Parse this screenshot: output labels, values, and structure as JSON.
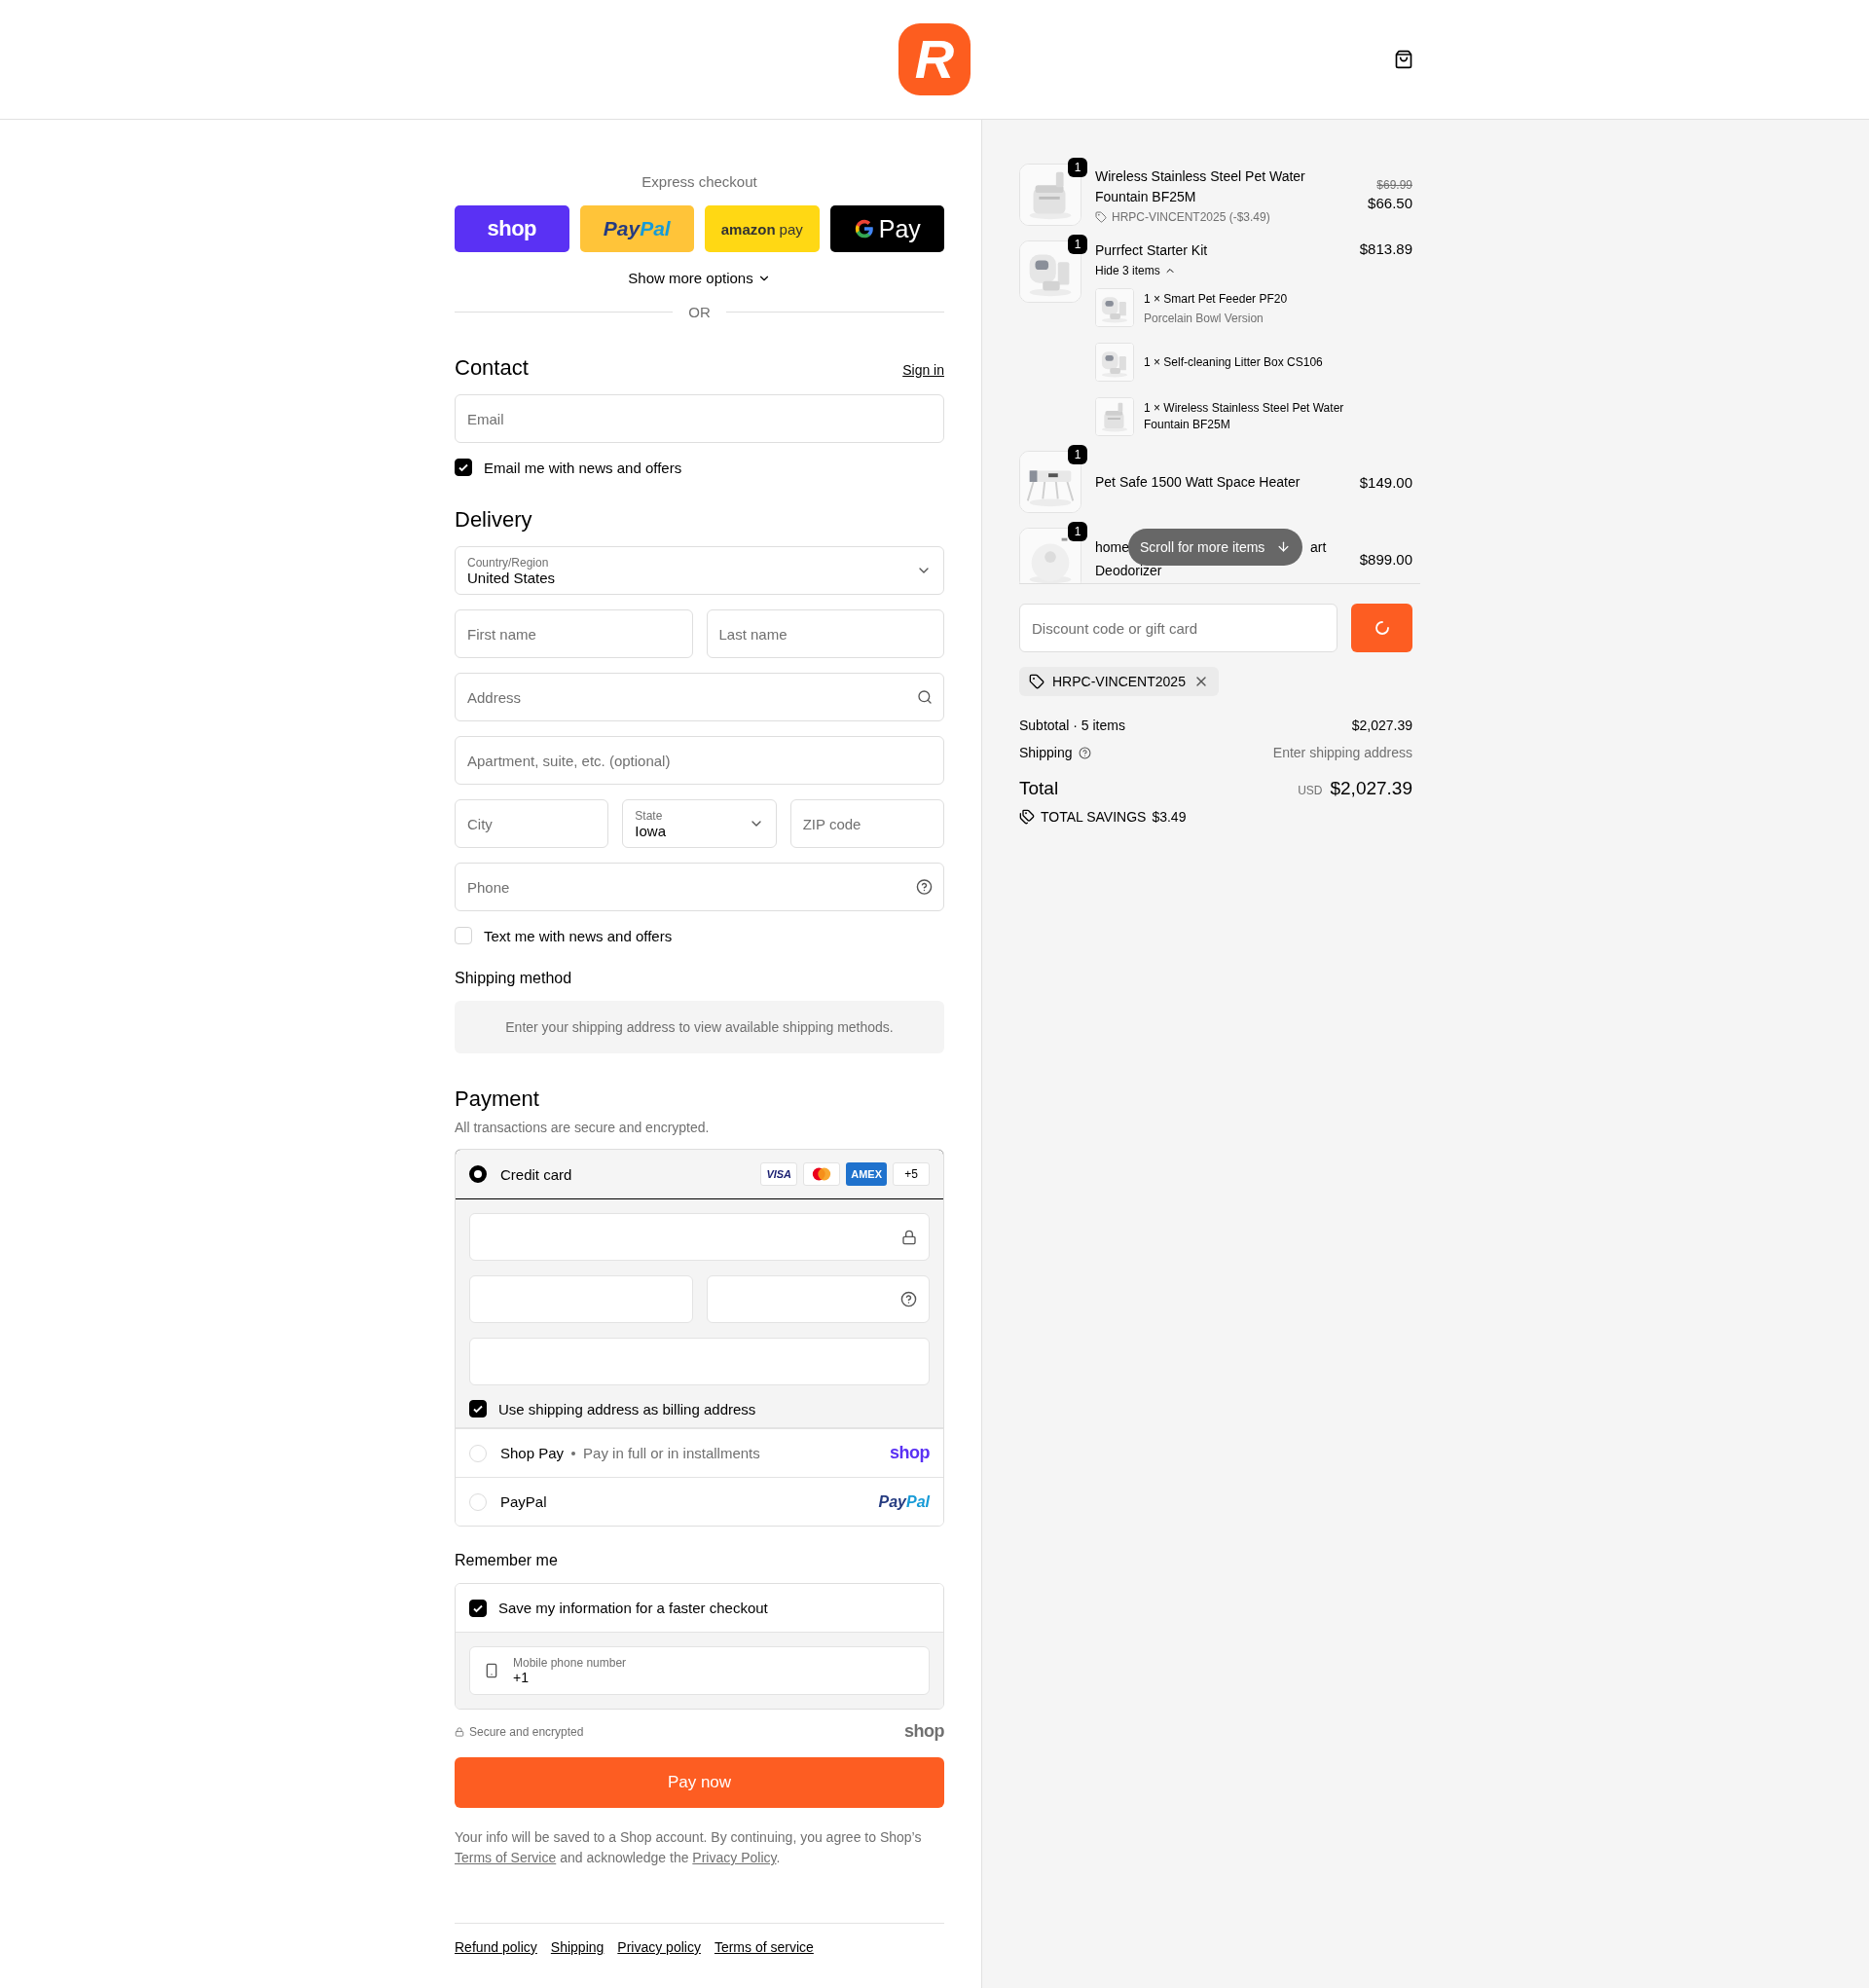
{
  "header": {
    "logo_letter": "R"
  },
  "express": {
    "title": "Express checkout",
    "buttons": [
      {
        "kind": "shop",
        "parts": [
          "shop"
        ]
      },
      {
        "kind": "paypal",
        "parts": [
          "Pay",
          "Pal"
        ]
      },
      {
        "kind": "amazon",
        "parts": [
          "amazon",
          "pay"
        ]
      },
      {
        "kind": "gpay",
        "parts": [
          "Pay"
        ]
      }
    ],
    "more": "Show more options",
    "divider": "OR"
  },
  "contact": {
    "title": "Contact",
    "sign_in": "Sign in",
    "email": {
      "placeholder": "Email"
    },
    "offers": {
      "label": "Email me with news and offers",
      "checked": true
    }
  },
  "delivery": {
    "title": "Delivery",
    "country": {
      "label": "Country/Region",
      "value": "United States"
    },
    "first_name": {
      "placeholder": "First name"
    },
    "last_name": {
      "placeholder": "Last name"
    },
    "address": {
      "placeholder": "Address"
    },
    "apartment": {
      "placeholder": "Apartment, suite, etc. (optional)"
    },
    "city": {
      "placeholder": "City"
    },
    "state": {
      "label": "State",
      "value": "Iowa"
    },
    "zip": {
      "placeholder": "ZIP code"
    },
    "phone": {
      "placeholder": "Phone"
    },
    "sms": {
      "label": "Text me with news and offers",
      "checked": false
    }
  },
  "shipping_method": {
    "title": "Shipping method",
    "notice": "Enter your shipping address to view available shipping methods."
  },
  "payment": {
    "title": "Payment",
    "subtitle": "All transactions are secure and encrypted.",
    "methods": [
      {
        "kind": "card",
        "label": "Credit card",
        "selected": true,
        "brands": [
          {
            "kind": "visa",
            "label": "VISA"
          },
          {
            "kind": "mastercard"
          },
          {
            "kind": "amex",
            "label": "AMEX"
          },
          {
            "kind": "more",
            "label": "+5"
          }
        ]
      },
      {
        "kind": "shop_pay",
        "label": "Shop Pay",
        "note": "Pay in full or in installments",
        "logo_parts": [
          "shop"
        ],
        "selected": false
      },
      {
        "kind": "paypal",
        "label": "PayPal",
        "logo_parts": [
          "Pay",
          "Pal"
        ],
        "selected": false
      }
    ],
    "billing": {
      "label": "Use shipping address as billing address",
      "checked": true
    }
  },
  "remember": {
    "title": "Remember me",
    "save": {
      "label": "Save my information for a faster checkout",
      "checked": true
    },
    "phone": {
      "label": "Mobile phone number",
      "value": "+1"
    }
  },
  "secure": "Secure and encrypted",
  "shop_logo": "shop",
  "pay_button": "Pay now",
  "legal": [
    {
      "text": "Your info will be saved to a Shop account. By continuing, you agree to Shop’s "
    },
    {
      "text": "Terms of Service",
      "link": true
    },
    {
      "text": " and acknowledge the "
    },
    {
      "text": "Privacy Policy",
      "link": true
    },
    {
      "text": "."
    }
  ],
  "footer_links": [
    "Refund policy",
    "Shipping",
    "Privacy policy",
    "Terms of service"
  ],
  "summary": {
    "items": [
      {
        "kind": "full",
        "quantity": "1",
        "name": "Wireless Stainless Steel Pet Water Fountain BF25M",
        "compare_price": "$69.99",
        "price": "$66.50",
        "discount": "HRPC-VINCENT2025 (-$3.49)"
      },
      {
        "kind": "full",
        "quantity": "1",
        "name": "Purrfect Starter Kit",
        "price": "$813.89",
        "toggle": "Hide 3 items",
        "expanded": true,
        "components": [
          {
            "label": "1 × Smart Pet Feeder PF20",
            "variant": "Porcelain Bowl Version"
          },
          {
            "label": "1 × Self-cleaning Litter Box CS106"
          },
          {
            "label": "1 × Wireless Stainless Steel Pet Water Fountain BF25M"
          }
        ]
      },
      {
        "kind": "full",
        "quantity": "1",
        "name": "Pet Safe 1500 Watt Space Heater",
        "price": "$149.00"
      },
      {
        "kind": "partial",
        "quantity": "1",
        "name_parts": [
          "home",
          "art",
          "Deodorizer"
        ],
        "price": "$899.00"
      }
    ],
    "scroll_hint": "Scroll for more items",
    "discount": {
      "placeholder": "Discount code or gift card"
    },
    "applied_code": "HRPC-VINCENT2025",
    "subtotal": {
      "label": "Subtotal · 5 items",
      "value": "$2,027.39"
    },
    "shipping": {
      "label": "Shipping",
      "value": "Enter shipping address"
    },
    "total": {
      "label": "Total",
      "currency": "USD",
      "value": "$2,027.39"
    },
    "savings": {
      "label": "TOTAL SAVINGS",
      "value": "$3.49"
    }
  }
}
